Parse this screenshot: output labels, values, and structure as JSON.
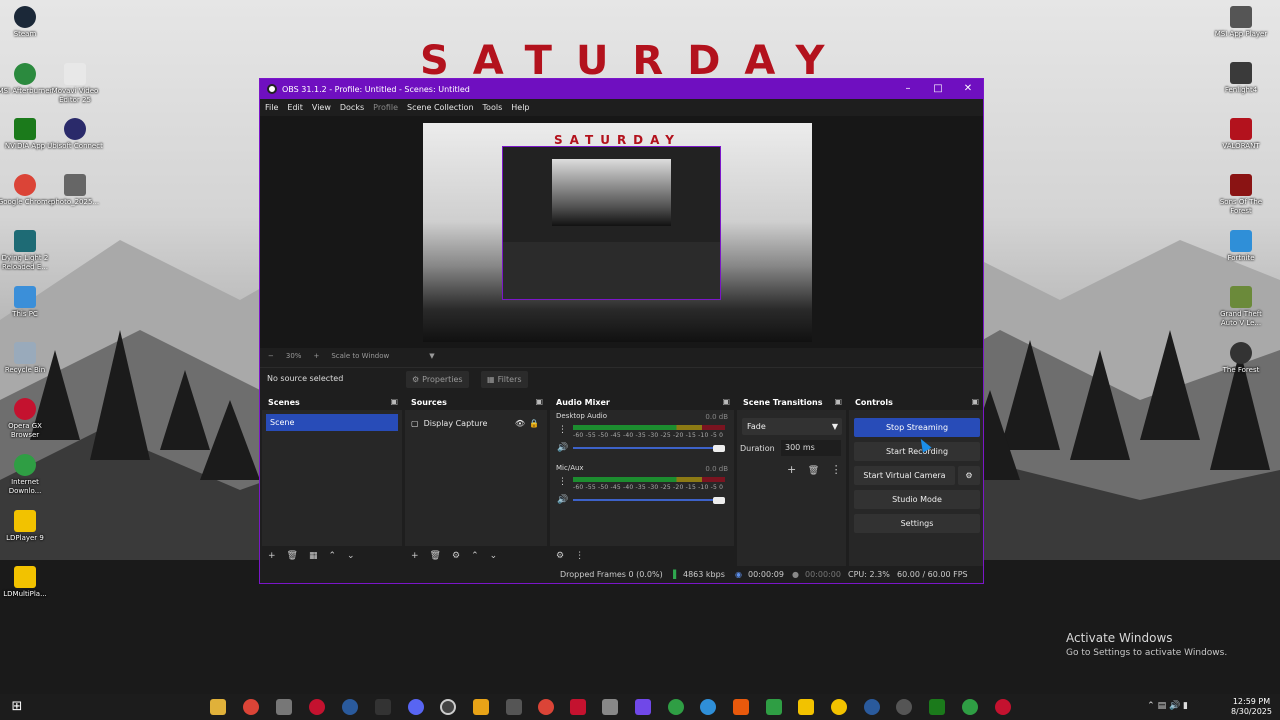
{
  "desktop": {
    "banner": "SATURDAY",
    "left_icons": [
      {
        "label": "Steam",
        "color": "#1b2838"
      },
      {
        "label": "MSI Afterburner",
        "color": "#2b8a3e"
      },
      {
        "label": "Movavi Video Editor 25",
        "color": "#e8e8e8"
      },
      {
        "label": "NVIDIA App",
        "color": "#1b7a1b"
      },
      {
        "label": "Ubisoft Connect",
        "color": "#2a2a6a"
      },
      {
        "label": "Google Chrome",
        "color": "#db4437"
      },
      {
        "label": "photo_2025...",
        "color": "#666666"
      },
      {
        "label": "Dying Light 2 Reloaded E...",
        "color": "#1e6b75"
      },
      {
        "label": "This PC",
        "color": "#3b8fd9"
      },
      {
        "label": "Recycle Bin",
        "color": "#9ab"
      },
      {
        "label": "Opera GX Browser",
        "color": "#c4122f"
      },
      {
        "label": "Internet Downlo...",
        "color": "#2f9e44"
      },
      {
        "label": "LDPlayer 9",
        "color": "#f2c200"
      },
      {
        "label": "LDMultiPla...",
        "color": "#f2c200"
      }
    ],
    "right_icons": [
      {
        "label": "MSI App Player",
        "color": "#555"
      },
      {
        "label": "Fenlight4",
        "color": "#3a3a3a"
      },
      {
        "label": "VALORANT",
        "color": "#b3121d"
      },
      {
        "label": "Sons Of The Forest",
        "color": "#8a1313"
      },
      {
        "label": "Fortnite",
        "color": "#2f8fd8"
      },
      {
        "label": "Grand Theft Auto V Le...",
        "color": "#6b8a3a"
      },
      {
        "label": "The Forest",
        "color": "#333"
      }
    ],
    "watermark_title": "Activate Windows",
    "watermark_sub": "Go to Settings to activate Windows."
  },
  "obs": {
    "title": "OBS 31.1.2 - Profile: Untitled - Scenes: Untitled",
    "menu": [
      "File",
      "Edit",
      "View",
      "Docks",
      "Profile",
      "Scene Collection",
      "Tools",
      "Help"
    ],
    "preview_title": "SATURDAY",
    "zoom": {
      "minus": "−",
      "value": "30%",
      "plus": "+",
      "mode": "Scale to Window"
    },
    "no_source": "No source selected",
    "properties_label": "Properties",
    "filters_label": "Filters",
    "scenes": {
      "title": "Scenes",
      "items": [
        "Scene"
      ]
    },
    "sources": {
      "title": "Sources",
      "items": [
        "Display Capture"
      ]
    },
    "audio_mixer": {
      "title": "Audio Mixer",
      "ticks": "-60 -55 -50 -45 -40 -35 -30 -25 -20 -15 -10 -5 0",
      "channels": [
        {
          "name": "Desktop Audio",
          "db": "0.0 dB",
          "level": 1.0
        },
        {
          "name": "Mic/Aux",
          "db": "0.0 dB",
          "level": 1.0
        }
      ]
    },
    "transitions": {
      "title": "Scene Transitions",
      "selected": "Fade",
      "duration_label": "Duration",
      "duration": "300 ms"
    },
    "controls": {
      "title": "Controls",
      "stop_streaming": "Stop Streaming",
      "start_recording": "Start Recording",
      "start_virtual_camera": "Start Virtual Camera",
      "studio_mode": "Studio Mode",
      "settings": "Settings"
    },
    "status": {
      "dropped_frames": "Dropped Frames 0 (0.0%)",
      "bitrate": "4863 kbps",
      "stream_time": "00:00:09",
      "record_time": "00:00:00",
      "cpu": "CPU: 2.3%",
      "fps": "60.00 / 60.00 FPS"
    }
  },
  "taskbar": {
    "icons": [
      "start",
      "file-explorer",
      "chrome",
      "notepad",
      "opera",
      "steam",
      "epic-games",
      "discord",
      "obs",
      "vegas",
      "game",
      "chrome-2",
      "youtube",
      "notion",
      "teamviewer",
      "edge",
      "telegram",
      "game-2",
      "msi",
      "ldplayer",
      "ldmulti",
      "steam-2",
      "settings",
      "nvidia",
      "xbox",
      "opera-gx"
    ],
    "time": "12:59 PM",
    "date": "8/30/2025"
  }
}
